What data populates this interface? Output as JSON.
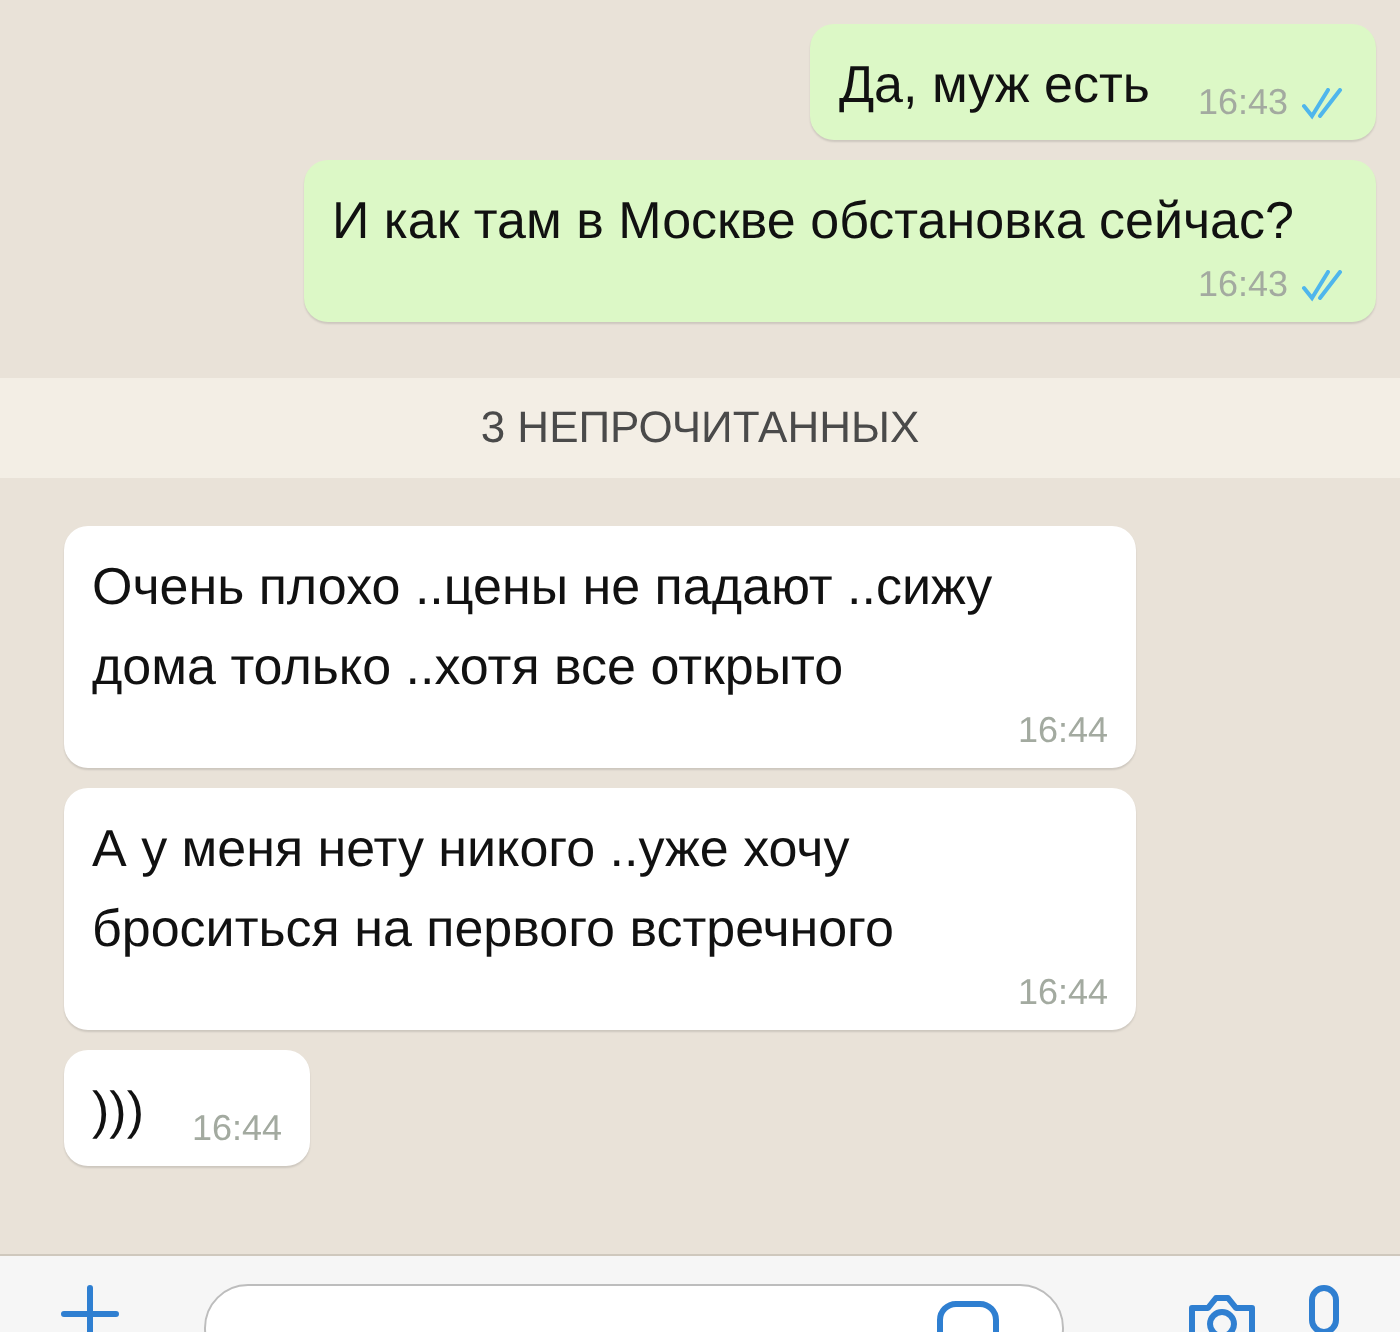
{
  "messages": [
    {
      "kind": "outgoing",
      "text": "Да, муж есть",
      "time": "16:43",
      "read": true
    },
    {
      "kind": "outgoing",
      "text": "И как там в Москве обстановка сейчас?",
      "time": "16:43",
      "read": true
    },
    {
      "kind": "divider",
      "text": "3 НЕПРОЧИТАННЫХ"
    },
    {
      "kind": "incoming",
      "text": "Очень плохо ..цены не падают ..сижу дома только ..хотя все открыто",
      "time": "16:44"
    },
    {
      "kind": "incoming",
      "text": "А у меня нету никого ..уже хочу броситься на первого встречного",
      "time": "16:44"
    },
    {
      "kind": "incoming",
      "text": ")))",
      "time": "16:44"
    }
  ]
}
